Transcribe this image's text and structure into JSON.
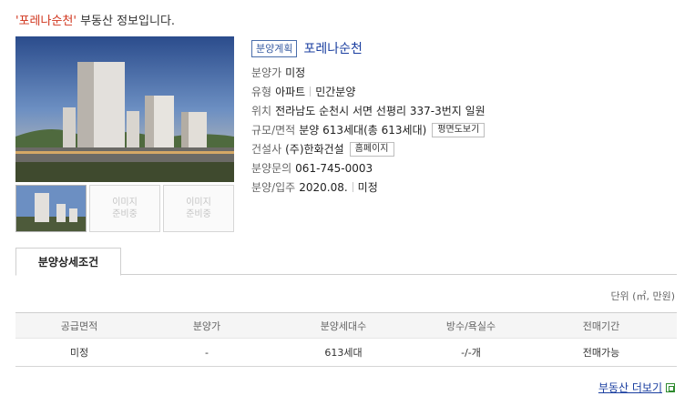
{
  "headline": {
    "quoted_name": "'포레나순천'",
    "suffix": " 부동산 정보입니다."
  },
  "gallery": {
    "placeholder_1": "이미지\n준비중",
    "placeholder_2": "이미지\n준비중"
  },
  "info": {
    "tag": "분양계획",
    "name": "포레나순천",
    "price_label": "분양가",
    "price_value": "미정",
    "type_label": "유형",
    "type_value_1": "아파트",
    "type_value_2": "민간분양",
    "location_label": "위치",
    "location_value": "전라남도 순천시 서면 선평리 337-3번지 일원",
    "scale_label": "규모/면적",
    "scale_value": "분양 613세대(총 613세대)",
    "floor_plan_button": "평면도보기",
    "builder_label": "건설사",
    "builder_value": "(주)한화건설",
    "homepage_button": "홈페이지",
    "contact_label": "분양문의",
    "contact_value": "061-745-0003",
    "schedule_label": "분양/입주",
    "schedule_value_1": "2020.08.",
    "schedule_value_2": "미정"
  },
  "tabs": {
    "active": "분양상세조건"
  },
  "unit_note": "단위 (㎡, 만원)",
  "table": {
    "headers": [
      "공급면적",
      "분양가",
      "분양세대수",
      "방수/욕실수",
      "전매기간"
    ],
    "rows": [
      [
        "미정",
        "-",
        "613세대",
        "-/-개",
        "전매가능"
      ]
    ]
  },
  "more_link": "부동산 더보기"
}
